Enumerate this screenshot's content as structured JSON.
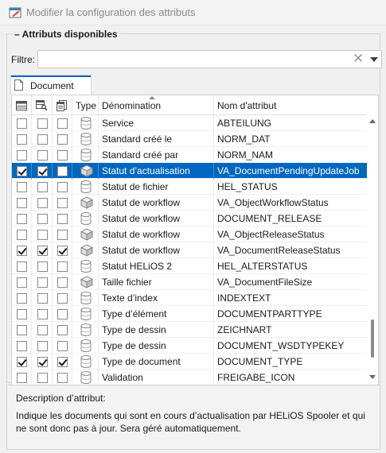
{
  "window": {
    "title": "Modifier la configuration des attributs"
  },
  "group": {
    "legend": "Attributs disponibles"
  },
  "filter": {
    "label": "Filtre:",
    "value": "",
    "clear_glyph": "✕"
  },
  "tab": {
    "label": "Document"
  },
  "grid": {
    "columns": {
      "type": "Type",
      "name": "Dénomination",
      "attr": "Nom d'attribut"
    },
    "rows": [
      {
        "c1": false,
        "c2": false,
        "c3": false,
        "icon": "cylinder",
        "name": "Service",
        "attr": "ABTEILUNG",
        "selected": false
      },
      {
        "c1": false,
        "c2": false,
        "c3": false,
        "icon": "cylinder",
        "name": "Standard créé le",
        "attr": "NORM_DAT",
        "selected": false
      },
      {
        "c1": false,
        "c2": false,
        "c3": false,
        "icon": "cylinder",
        "name": "Standard créé par",
        "attr": "NORM_NAM",
        "selected": false
      },
      {
        "c1": true,
        "c2": true,
        "c3": false,
        "icon": "cube",
        "name": "Statut d’actualisation",
        "attr": "VA_DocumentPendingUpdateJob",
        "selected": true
      },
      {
        "c1": false,
        "c2": false,
        "c3": false,
        "icon": "cylinder",
        "name": "Statut de fichier",
        "attr": "HEL_STATUS",
        "selected": false
      },
      {
        "c1": false,
        "c2": false,
        "c3": false,
        "icon": "cube",
        "name": "Statut de workflow",
        "attr": "VA_ObjectWorkflowStatus",
        "selected": false
      },
      {
        "c1": false,
        "c2": false,
        "c3": false,
        "icon": "cylinder",
        "name": "Statut de workflow",
        "attr": "DOCUMENT_RELEASE",
        "selected": false
      },
      {
        "c1": false,
        "c2": false,
        "c3": false,
        "icon": "cube",
        "name": "Statut de workflow",
        "attr": "VA_ObjectReleaseStatus",
        "selected": false
      },
      {
        "c1": true,
        "c2": true,
        "c3": true,
        "icon": "cube",
        "name": "Statut de workflow",
        "attr": "VA_DocumentReleaseStatus",
        "selected": false
      },
      {
        "c1": false,
        "c2": false,
        "c3": false,
        "icon": "cylinder",
        "name": "Statut HELiOS 2",
        "attr": "HEL_ALTERSTATUS",
        "selected": false
      },
      {
        "c1": false,
        "c2": false,
        "c3": false,
        "icon": "cube",
        "name": "Taille fichier",
        "attr": "VA_DocumentFileSize",
        "selected": false
      },
      {
        "c1": false,
        "c2": false,
        "c3": false,
        "icon": "cylinder",
        "name": "Texte d’index",
        "attr": "INDEXTEXT",
        "selected": false
      },
      {
        "c1": false,
        "c2": false,
        "c3": false,
        "icon": "cylinder",
        "name": "Type d’élément",
        "attr": "DOCUMENTPARTTYPE",
        "selected": false
      },
      {
        "c1": false,
        "c2": false,
        "c3": false,
        "icon": "cylinder",
        "name": "Type de dessin",
        "attr": "ZEICHNART",
        "selected": false
      },
      {
        "c1": false,
        "c2": false,
        "c3": false,
        "icon": "cylinder",
        "name": "Type de dessin",
        "attr": "DOCUMENT_WSDTYPEKEY",
        "selected": false
      },
      {
        "c1": true,
        "c2": true,
        "c3": true,
        "icon": "cylinder",
        "name": "Type de document",
        "attr": "DOCUMENT_TYPE",
        "selected": false
      },
      {
        "c1": false,
        "c2": false,
        "c3": false,
        "icon": "cylinder",
        "name": "Validation",
        "attr": "FREIGABE_ICON",
        "selected": false
      }
    ]
  },
  "description": {
    "title": "Description d’attribut:",
    "text": "Indique les documents qui sont en cours d’actualisation par HELiOS Spooler et qui ne sont donc pas à jour. Sera géré automatiquement."
  },
  "colors": {
    "accent": "#0067c0"
  }
}
